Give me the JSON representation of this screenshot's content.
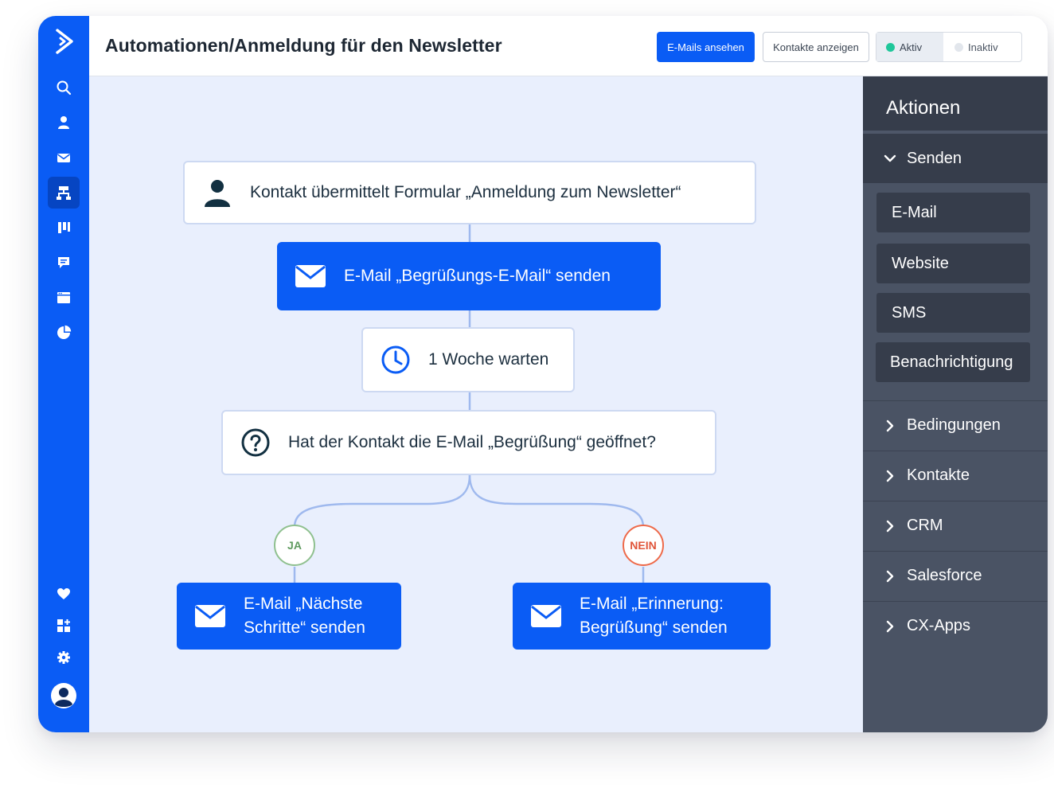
{
  "header": {
    "title": "Automationen/Anmeldung für den Newsletter",
    "view_emails_button": "E-Mails ansehen",
    "show_contacts_button": "Kontakte anzeigen",
    "status_toggle": {
      "active_label": "Aktiv",
      "inactive_label": "Inaktiv",
      "selected": "Aktiv"
    }
  },
  "sidebar": {
    "items": [
      {
        "icon": "search-icon"
      },
      {
        "icon": "contacts-icon"
      },
      {
        "icon": "envelope-icon"
      },
      {
        "icon": "automations-icon",
        "active": true
      },
      {
        "icon": "deals-board-icon"
      },
      {
        "icon": "conversations-icon"
      },
      {
        "icon": "website-icon"
      },
      {
        "icon": "reports-icon"
      }
    ],
    "bottom_items": [
      {
        "icon": "heart-icon"
      },
      {
        "icon": "apps-icon"
      },
      {
        "icon": "gear-icon"
      },
      {
        "icon": "avatar-icon"
      }
    ]
  },
  "workflow": {
    "trigger": "Kontakt übermittelt Formular „Anmeldung zum Newsletter“",
    "send_welcome": "E-Mail „Begrüßungs-E-Mail“ senden",
    "wait": "1 Woche warten",
    "condition": "Hat der Kontakt die E-Mail „Begrüßung“ geöffnet?",
    "yes_label": "JA",
    "no_label": "NEIN",
    "yes_action_line1": "E-Mail „Nächste",
    "yes_action_line2": "Schritte“ senden",
    "no_action_line1": "E-Mail „Erinnerung:",
    "no_action_line2": "Begrüßung“ senden"
  },
  "actions_panel": {
    "title": "Aktionen",
    "open_section": "Senden",
    "send_items": [
      "E-Mail",
      "Website",
      "SMS",
      "Benachrichtigung"
    ],
    "sections": [
      "Bedingungen",
      "Kontakte",
      "CRM",
      "Salesforce",
      "CX-Apps"
    ]
  },
  "colors": {
    "brand_blue": "#0a5cf5",
    "canvas_bg": "#e9effd",
    "panel_bg": "#4a5364",
    "panel_dark": "#363d4b",
    "yes_green": "#8fc08f",
    "no_red": "#ee6a4a",
    "active_dot": "#1fc79a"
  }
}
